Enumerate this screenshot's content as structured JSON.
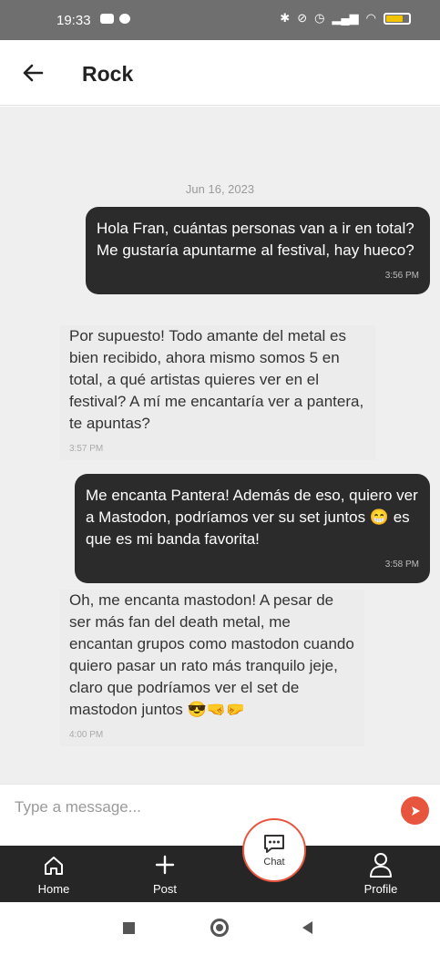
{
  "status_bar": {
    "time": "19:33",
    "battery_level": 0.75
  },
  "header": {
    "title": "Rock"
  },
  "chat": {
    "date": "Jun 16, 2023",
    "messages": [
      {
        "direction": "outgoing",
        "text": "Hola Fran, cuántas personas van a ir en total? Me gustaría apuntarme al festival, hay hueco?",
        "time": "3:56 PM"
      },
      {
        "direction": "incoming",
        "text": "Por supuesto! Todo amante del metal es bien recibido, ahora mismo somos 5 en total, a qué artistas quieres ver en el festival? A mí me encantaría ver a pantera, te apuntas?",
        "time": "3:57 PM"
      },
      {
        "direction": "outgoing",
        "text": "Me encanta Pantera! Además de eso, quiero ver a Mastodon, podríamos ver su set juntos 😁 es que es mi banda favorita!",
        "time": "3:58 PM"
      },
      {
        "direction": "incoming",
        "text": "Oh, me encanta mastodon! A pesar de ser más fan del death metal, me encantan grupos como mastodon cuando quiero pasar un rato más tranquilo jeje, claro que podríamos ver el set de mastodon juntos 😎🤜🤛",
        "time": "4:00 PM"
      }
    ]
  },
  "composer": {
    "placeholder": "Type a message..."
  },
  "nav": {
    "items": [
      {
        "label": "Home",
        "icon": "home-icon"
      },
      {
        "label": "Post",
        "icon": "plus-icon"
      },
      {
        "label": "Chat",
        "icon": "chat-bubble-icon"
      },
      {
        "label": "Profile",
        "icon": "user-icon"
      }
    ]
  },
  "colors": {
    "accent": "#e8553e",
    "nav_background": "#262626",
    "outgoing_bubble": "#2b2b2b",
    "chat_background": "#efefef"
  }
}
